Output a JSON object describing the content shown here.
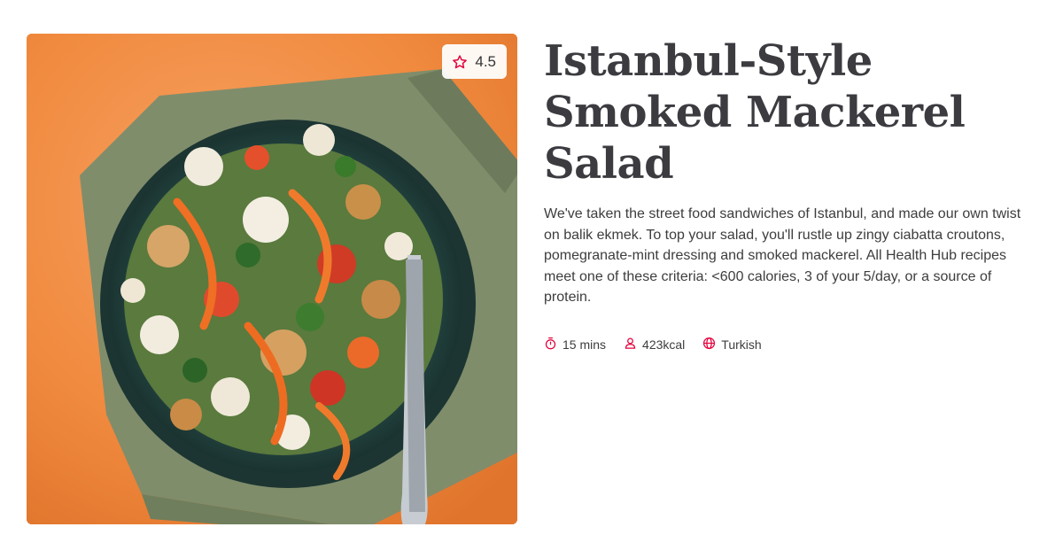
{
  "recipe": {
    "title": "Istanbul-Style Smoked Mackerel Salad",
    "description": "We've taken the street food sandwiches of Istanbul, and made our own twist on balik ekmek. To top your salad, you'll rustle up zingy ciabatta croutons, pomegranate-mint dressing and smoked mackerel. All Health Hub recipes meet one of these criteria: <600 calories, 3 of your 5/day, or a source of protein.",
    "rating": "4.5",
    "meta": {
      "time": "15 mins",
      "calories": "423kcal",
      "cuisine": "Turkish"
    }
  },
  "icons": {
    "rating": "star-icon",
    "time": "timer-icon",
    "calories": "person-icon",
    "cuisine": "globe-icon"
  },
  "colors": {
    "accent": "#e4003b",
    "title": "#3b3b40",
    "background": "#ffffff",
    "photo_backdrop": "#f0873a"
  }
}
